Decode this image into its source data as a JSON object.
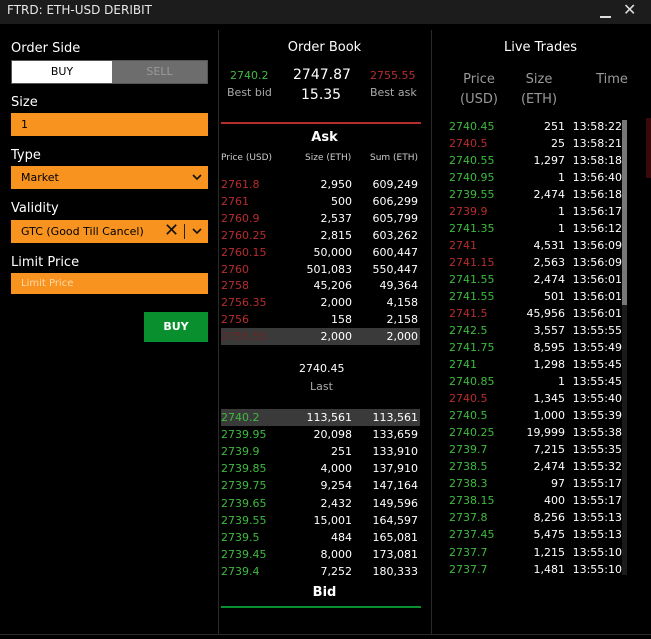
{
  "window": {
    "title": "FTRD: ETH-USD DERIBIT"
  },
  "order_form": {
    "side_label": "Order Side",
    "buy_label": "BUY",
    "sell_label": "SELL",
    "size_label": "Size",
    "size_value": "1",
    "type_label": "Type",
    "type_value": "Market",
    "validity_label": "Validity",
    "validity_value": "GTC (Good Till Cancel)",
    "limit_label": "Limit Price",
    "limit_placeholder": "Limit Price",
    "submit_label": "BUY"
  },
  "order_book": {
    "title": "Order Book",
    "best_bid": "2740.2",
    "best_bid_label": "Best bid",
    "last_price": "2747.87",
    "last_volume": "15.35",
    "best_ask": "2755.55",
    "best_ask_label": "Best ask",
    "ask_title": "Ask",
    "bid_title": "Bid",
    "col_price": "Price (USD)",
    "col_size": "Size (ETH)",
    "col_sum": "Sum (ETH)",
    "asks": [
      {
        "price": "2761.8",
        "size": "2,950",
        "sum": "609,249"
      },
      {
        "price": "2761",
        "size": "500",
        "sum": "606,299"
      },
      {
        "price": "2760.9",
        "size": "2,537",
        "sum": "605,799"
      },
      {
        "price": "2760.25",
        "size": "2,815",
        "sum": "603,262"
      },
      {
        "price": "2760.15",
        "size": "50,000",
        "sum": "600,447"
      },
      {
        "price": "2760",
        "size": "501,083",
        "sum": "550,447"
      },
      {
        "price": "2758",
        "size": "45,206",
        "sum": "49,364"
      },
      {
        "price": "2756.35",
        "size": "2,000",
        "sum": "4,158"
      },
      {
        "price": "2756",
        "size": "158",
        "sum": "2,158"
      },
      {
        "price": "2755.55",
        "size": "2,000",
        "sum": "2,000"
      }
    ],
    "mid_last_price": "2740.45",
    "mid_last_label": "Last",
    "bids": [
      {
        "price": "2740.2",
        "size": "113,561",
        "sum": "113,561"
      },
      {
        "price": "2739.95",
        "size": "20,098",
        "sum": "133,659"
      },
      {
        "price": "2739.9",
        "size": "251",
        "sum": "133,910"
      },
      {
        "price": "2739.85",
        "size": "4,000",
        "sum": "137,910"
      },
      {
        "price": "2739.75",
        "size": "9,254",
        "sum": "147,164"
      },
      {
        "price": "2739.65",
        "size": "2,432",
        "sum": "149,596"
      },
      {
        "price": "2739.55",
        "size": "15,001",
        "sum": "164,597"
      },
      {
        "price": "2739.5",
        "size": "484",
        "sum": "165,081"
      },
      {
        "price": "2739.45",
        "size": "8,000",
        "sum": "173,081"
      },
      {
        "price": "2739.4",
        "size": "7,252",
        "sum": "180,333"
      }
    ]
  },
  "live_trades": {
    "title": "Live Trades",
    "col_price": "Price\n(USD)",
    "col_size": "Size\n(ETH)",
    "col_time": "Time",
    "trades": [
      {
        "price": "2740.45",
        "size": "251",
        "time": "13:58:22",
        "side": "buy"
      },
      {
        "price": "2740.5",
        "size": "25",
        "time": "13:58:21",
        "side": "sell"
      },
      {
        "price": "2740.55",
        "size": "1,297",
        "time": "13:58:18",
        "side": "buy"
      },
      {
        "price": "2740.95",
        "size": "1",
        "time": "13:56:40",
        "side": "buy"
      },
      {
        "price": "2739.55",
        "size": "2,474",
        "time": "13:56:18",
        "side": "buy"
      },
      {
        "price": "2739.9",
        "size": "1",
        "time": "13:56:17",
        "side": "sell"
      },
      {
        "price": "2741.35",
        "size": "1",
        "time": "13:56:12",
        "side": "buy"
      },
      {
        "price": "2741",
        "size": "4,531",
        "time": "13:56:09",
        "side": "sell"
      },
      {
        "price": "2741.15",
        "size": "2,563",
        "time": "13:56:09",
        "side": "sell"
      },
      {
        "price": "2741.55",
        "size": "2,474",
        "time": "13:56:01",
        "side": "buy"
      },
      {
        "price": "2741.55",
        "size": "501",
        "time": "13:56:01",
        "side": "buy"
      },
      {
        "price": "2741.5",
        "size": "45,956",
        "time": "13:56:01",
        "side": "sell"
      },
      {
        "price": "2742.5",
        "size": "3,557",
        "time": "13:55:55",
        "side": "buy"
      },
      {
        "price": "2741.75",
        "size": "8,595",
        "time": "13:55:49",
        "side": "buy"
      },
      {
        "price": "2741",
        "size": "1,298",
        "time": "13:55:45",
        "side": "buy"
      },
      {
        "price": "2740.85",
        "size": "1",
        "time": "13:55:45",
        "side": "buy"
      },
      {
        "price": "2740.5",
        "size": "1,345",
        "time": "13:55:40",
        "side": "sell"
      },
      {
        "price": "2740.5",
        "size": "1,000",
        "time": "13:55:39",
        "side": "buy"
      },
      {
        "price": "2740.25",
        "size": "19,999",
        "time": "13:55:38",
        "side": "buy"
      },
      {
        "price": "2739.7",
        "size": "7,215",
        "time": "13:55:35",
        "side": "buy"
      },
      {
        "price": "2738.5",
        "size": "2,474",
        "time": "13:55:32",
        "side": "buy"
      },
      {
        "price": "2738.3",
        "size": "97",
        "time": "13:55:17",
        "side": "buy"
      },
      {
        "price": "2738.15",
        "size": "400",
        "time": "13:55:17",
        "side": "buy"
      },
      {
        "price": "2737.8",
        "size": "8,256",
        "time": "13:55:13",
        "side": "buy"
      },
      {
        "price": "2737.45",
        "size": "5,475",
        "time": "13:55:13",
        "side": "buy"
      },
      {
        "price": "2737.7",
        "size": "1,215",
        "time": "13:55:10",
        "side": "buy"
      },
      {
        "price": "2737.7",
        "size": "1,481",
        "time": "13:55:10",
        "side": "buy"
      }
    ]
  },
  "colors": {
    "buy": "#3fba3f",
    "sell": "#b62d2d",
    "accent": "#f7931e",
    "submit": "#0a8f2e"
  }
}
